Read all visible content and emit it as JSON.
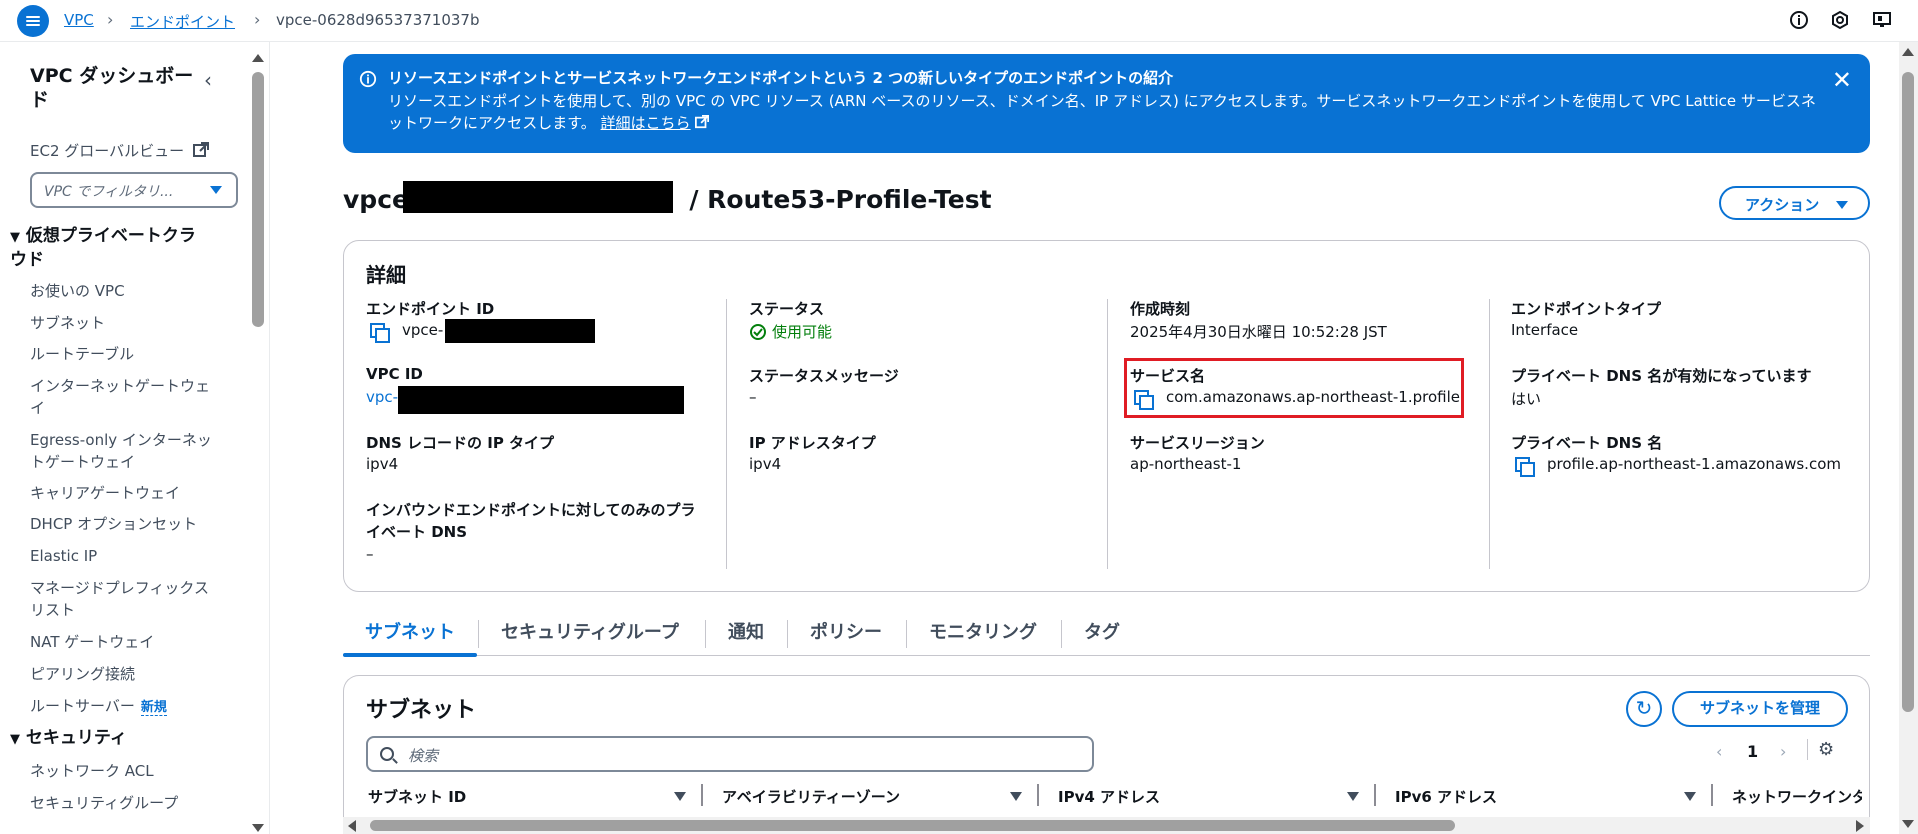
{
  "breadcrumb": {
    "items": [
      "VPC",
      "エンドポイント"
    ],
    "current": "vpce-0628d96537371037b"
  },
  "sidebar": {
    "title": "VPC ダッシュボード",
    "ec2_global_view": "EC2 グローバルビュー",
    "filter_placeholder": "VPC でフィルタリ...",
    "section_vpc": "仮想プライベートクラウド",
    "items": [
      "お使いの VPC",
      "サブネット",
      "ルートテーブル",
      "インターネットゲートウェイ",
      "Egress-only インターネットゲートウェイ",
      "キャリアゲートウェイ",
      "DHCP オプションセット",
      "Elastic IP",
      "マネージドプレフィックスリスト",
      "NAT ゲートウェイ",
      "ピアリング接続",
      "ルートサーバー"
    ],
    "new_badge": "新規",
    "section_security": "セキュリティ",
    "security_items": [
      "ネットワーク ACL",
      "セキュリティグループ"
    ]
  },
  "banner": {
    "title": "リソースエンドポイントとサービスネットワークエンドポイントという 2 つの新しいタイプのエンドポイントの紹介",
    "body": "リソースエンドポイントを使用して、別の VPC の VPC リソース (ARN ベースのリソース、ドメイン名、IP アドレス) にアクセスします。サービスネットワークエンドポイントを使用して VPC Lattice サービスネットワークにアクセスします。",
    "link": "詳細はこちら"
  },
  "page": {
    "title_prefix": "vpce-",
    "title_suffix": "/ Route53-Profile-Test",
    "action_button": "アクション"
  },
  "details": {
    "heading": "詳細",
    "endpoint_id_label": "エンドポイント ID",
    "endpoint_id_value": "vpce-",
    "vpc_id_label": "VPC ID",
    "vpc_id_value": "vpc-",
    "dns_ip_type_label": "DNS レコードの IP タイプ",
    "dns_ip_type_value": "ipv4",
    "inbound_label": "インバウンドエンドポイントに対してのみのプライベート DNS",
    "inbound_value": "–",
    "status_label": "ステータス",
    "status_value": "使用可能",
    "status_message_label": "ステータスメッセージ",
    "status_message_value": "–",
    "ip_type_label": "IP アドレスタイプ",
    "ip_type_value": "ipv4",
    "created_label": "作成時刻",
    "created_value": "2025年4月30日水曜日 10:52:28 JST",
    "service_name_label": "サービス名",
    "service_name_value": "com.amazonaws.ap-northeast-1.profile",
    "service_region_label": "サービスリージョン",
    "service_region_value": "ap-northeast-1",
    "endpoint_type_label": "エンドポイントタイプ",
    "endpoint_type_value": "Interface",
    "private_dns_enabled_label": "プライベート DNS 名が有効になっています",
    "private_dns_enabled_value": "はい",
    "private_dns_name_label": "プライベート DNS 名",
    "private_dns_name_value": "profile.ap-northeast-1.amazonaws.com"
  },
  "tabs": [
    "サブネット",
    "セキュリティグループ",
    "通知",
    "ポリシー",
    "モニタリング",
    "タグ"
  ],
  "subnet_panel": {
    "heading": "サブネット",
    "manage_button": "サブネットを管理",
    "search_placeholder": "検索",
    "page_number": "1",
    "columns": [
      "サブネット ID",
      "アベイラビリティーゾーン",
      "IPv4 アドレス",
      "IPv6 アドレス",
      "ネットワークインタ"
    ]
  },
  "colors": {
    "primary": "#0972d3",
    "success": "#037f0c",
    "highlight": "#e01c24"
  }
}
